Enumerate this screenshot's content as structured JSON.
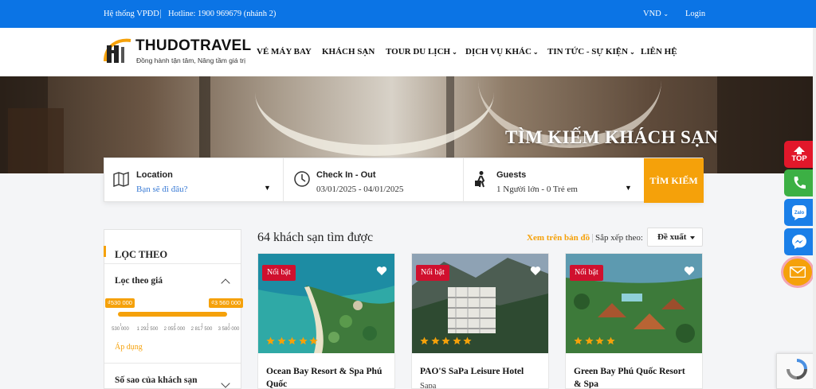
{
  "topbar": {
    "system_label": "Hệ thống VPĐD",
    "hotline": "Hotline: 1900 969679 (nhánh 2)",
    "currency": "VND",
    "login": "Login"
  },
  "brand": {
    "name": "THUDOTRAVEL",
    "tagline": "Đồng hành tận tâm, Nâng tầm giá trị"
  },
  "nav": {
    "items": [
      {
        "label": "VÉ MÁY BAY",
        "dropdown": false
      },
      {
        "label": "KHÁCH SẠN",
        "dropdown": false
      },
      {
        "label": "TOUR DU LỊCH",
        "dropdown": true
      },
      {
        "label": "DỊCH VỤ KHÁC",
        "dropdown": true
      },
      {
        "label": "TIN TỨC - SỰ KIỆN",
        "dropdown": true
      },
      {
        "label": "LIÊN HỆ",
        "dropdown": false
      }
    ]
  },
  "hero": {
    "title": "TÌM KIẾM KHÁCH SẠN"
  },
  "search": {
    "location_label": "Location",
    "location_placeholder": "Bạn sẽ đi đâu?",
    "dates_label": "Check In - Out",
    "dates_value": "03/01/2025 - 04/01/2025",
    "guests_label": "Guests",
    "guests_value": "1 Người lớn - 0 Trẻ em",
    "button": "TÌM KIẾM"
  },
  "filter": {
    "title": "LỌC THEO",
    "price_section": "Lọc theo giá",
    "min_price": "₫530 000",
    "max_price": "₫3 560 000",
    "ticks": [
      "530 000",
      "1 292 500",
      "2 055 000",
      "2 817 500",
      "3 580 000"
    ],
    "apply": "Áp dụng",
    "stars_section": "Số sao của khách sạn"
  },
  "results": {
    "count_text": "64 khách sạn tìm được",
    "map_link": "Xem trên bản đồ",
    "sort_label": "Sắp xếp theo:",
    "sort_value": "Đề xuất"
  },
  "hotels": [
    {
      "badge": "Nổi bật",
      "name": "Ocean Bay Resort & Spa Phú Quốc",
      "location": "",
      "stars": 5
    },
    {
      "badge": "Nổi bật",
      "name": "PAO'S SaPa Leisure Hotel",
      "location": "Sapa",
      "stars": 5
    },
    {
      "badge": "Nổi bật",
      "name": "Green Bay Phú Quốc Resort & Spa",
      "location": "",
      "stars": 4
    }
  ],
  "floating": {
    "top": "TOP",
    "icons": [
      "arrow-up-icon",
      "phone-icon",
      "zalo-icon",
      "messenger-icon",
      "mail-icon"
    ]
  },
  "colors": {
    "topbar": "#0b74e5",
    "accent": "#f5a10a",
    "badge": "#d0102e",
    "star": "#f5a10a"
  }
}
